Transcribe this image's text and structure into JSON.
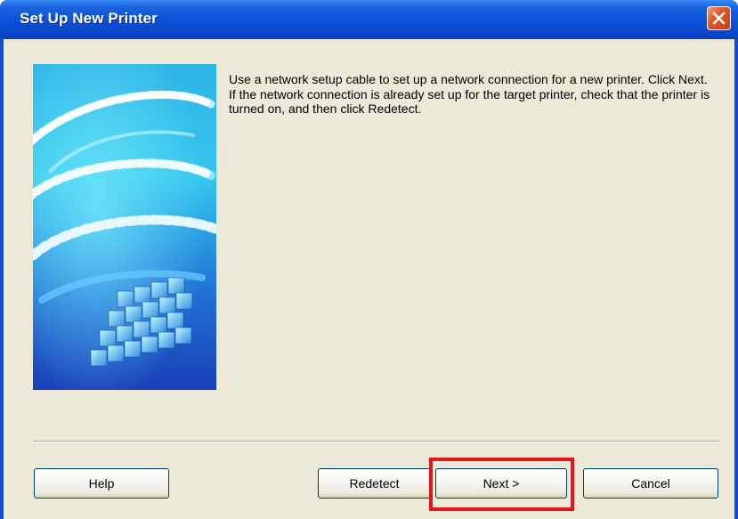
{
  "window": {
    "title": "Set Up New Printer",
    "close_icon": "close-icon"
  },
  "message": {
    "line1": "Use a network setup cable to set up a network connection for a new printer. Click Next.",
    "line2": "If the network connection is already set up for the target printer, check that the printer is turned on, and then click Redetect."
  },
  "buttons": {
    "help": "Help",
    "redetect": "Redetect",
    "next": "Next >",
    "cancel": "Cancel"
  },
  "colors": {
    "titlebar": "#0a4fd8",
    "dialog_bg": "#ece9d8",
    "highlight": "#e8141c"
  }
}
